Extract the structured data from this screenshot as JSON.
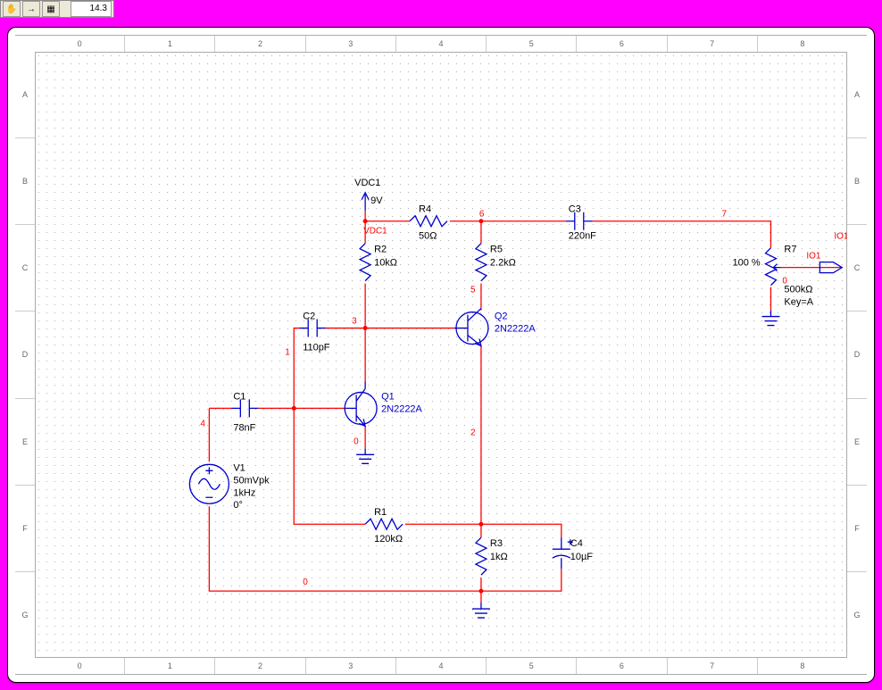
{
  "toolbar": {
    "grab": "✋",
    "arrow": "→",
    "chip": "▦",
    "value": "14.3"
  },
  "ruler": {
    "h": [
      "0",
      "1",
      "2",
      "3",
      "4",
      "5",
      "6",
      "7",
      "8"
    ],
    "v": [
      "A",
      "B",
      "C",
      "D",
      "E",
      "F",
      "G"
    ]
  },
  "parts": {
    "VDC1": {
      "name": "VDC1",
      "value": "9V"
    },
    "R4": {
      "name": "R4",
      "value": "50Ω"
    },
    "R2": {
      "name": "R2",
      "value": "10kΩ"
    },
    "R5": {
      "name": "R5",
      "value": "2.2kΩ"
    },
    "C3": {
      "name": "C3",
      "value": "220nF"
    },
    "R7": {
      "name": "R7",
      "pct": "100 %",
      "value": "500kΩ",
      "key": "Key=A"
    },
    "C2": {
      "name": "C2",
      "value": "110pF"
    },
    "Q2": {
      "name": "Q2",
      "model": "2N2222A"
    },
    "C1": {
      "name": "C1",
      "value": "78nF"
    },
    "Q1": {
      "name": "Q1",
      "model": "2N2222A"
    },
    "V1": {
      "name": "V1",
      "amp": "50mVpk",
      "freq": "1kHz",
      "phase": "0°"
    },
    "R1": {
      "name": "R1",
      "value": "120kΩ"
    },
    "R3": {
      "name": "R3",
      "value": "1kΩ"
    },
    "C4": {
      "name": "C4",
      "value": "10µF"
    },
    "IO1": {
      "name": "IO1"
    }
  },
  "nets": {
    "n0": "0",
    "n1": "1",
    "n2": "2",
    "n3": "3",
    "n4": "4",
    "n5": "5",
    "n6": "6",
    "n7": "7",
    "vdc1": "VDC1",
    "io1": "IO1"
  }
}
